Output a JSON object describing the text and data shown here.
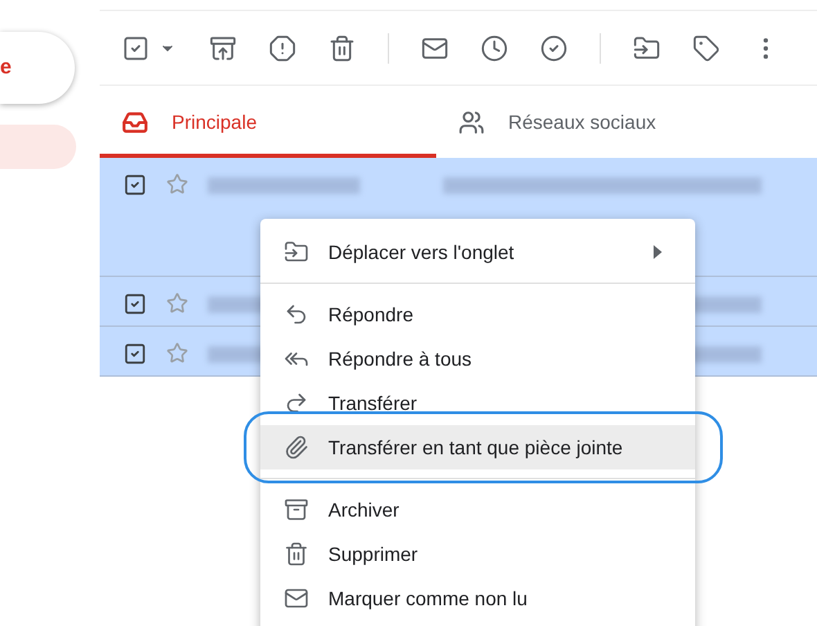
{
  "compose": {
    "label": "e"
  },
  "tabs": [
    {
      "label": "Principale",
      "selected": true
    },
    {
      "label": "Réseaux sociaux",
      "selected": false
    }
  ],
  "rows": [
    {
      "checked": true,
      "starred": false,
      "tall": true
    },
    {
      "checked": true,
      "starred": false,
      "tall": false
    },
    {
      "checked": true,
      "starred": false,
      "tall": false
    }
  ],
  "context_menu": {
    "sections": [
      {
        "items": [
          {
            "label": "Déplacer vers l'onglet",
            "submenu": true,
            "selected": false
          }
        ]
      },
      {
        "items": [
          {
            "label": "Répondre",
            "submenu": false,
            "selected": false
          },
          {
            "label": "Répondre à tous",
            "submenu": false,
            "selected": false
          },
          {
            "label": "Transférer",
            "submenu": false,
            "selected": false
          },
          {
            "label": "Transférer en tant que pièce jointe",
            "submenu": false,
            "selected": true
          }
        ]
      },
      {
        "items": [
          {
            "label": "Archiver",
            "submenu": false,
            "selected": false
          },
          {
            "label": "Supprimer",
            "submenu": false,
            "selected": false
          },
          {
            "label": "Marquer comme non lu",
            "submenu": false,
            "selected": false
          }
        ]
      }
    ]
  }
}
